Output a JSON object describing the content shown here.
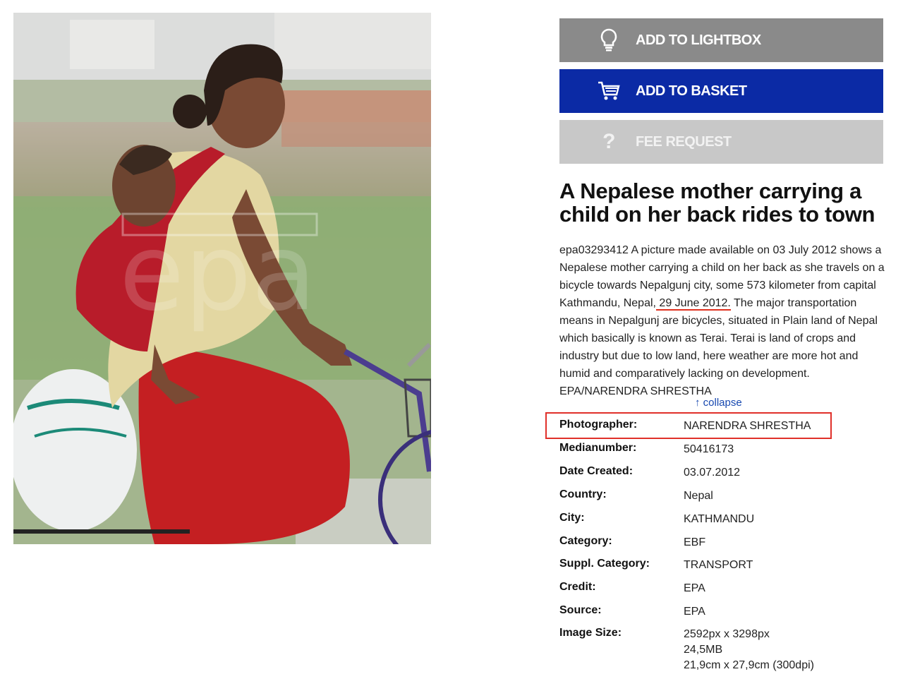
{
  "buttons": {
    "lightbox": "ADD TO LIGHTBOX",
    "basket": "ADD TO BASKET",
    "fee": "FEE REQUEST"
  },
  "icons": {
    "lightbox": "lightbulb-icon",
    "basket": "cart-icon",
    "fee": "question-mark-icon"
  },
  "colors": {
    "lightbox_bg": "#8a8a8a",
    "basket_bg": "#0b2aa5",
    "fee_bg": "#c8c8c8",
    "highlight": "#e0302a"
  },
  "photo": {
    "watermark": "epa"
  },
  "title": "A Nepalese mother carrying a child on her back rides to town",
  "description": {
    "part1": "epa03293412 A picture made available on 03 July 2012 shows a Nepalese mother carrying a child on her back as she travels on a bicycle towards Nepalgunj city, some 573 kilometer from capital Kathmandu, Nepal,",
    "date": " 29 June 2012.",
    "part2": " The major transportation means in Nepalgunj are bicycles, situated in Plain land of Nepal which basically is known as Terai. Terai is land of crops and industry but due to low land, here weather are more hot and humid and comparatively lacking on development. EPA/NARENDRA SHRESTHA"
  },
  "collapse": "↑ collapse",
  "meta": {
    "photographer": {
      "label": "Photographer:",
      "value": "NARENDRA SHRESTHA"
    },
    "medianumber": {
      "label": "Medianumber:",
      "value": "50416173"
    },
    "date_created": {
      "label": "Date Created:",
      "value": "03.07.2012"
    },
    "country": {
      "label": "Country:",
      "value": "Nepal"
    },
    "city": {
      "label": "City:",
      "value": "KATHMANDU"
    },
    "category": {
      "label": "Category:",
      "value": "EBF"
    },
    "suppl_category": {
      "label": "Suppl. Category:",
      "value": "TRANSPORT"
    },
    "credit": {
      "label": "Credit:",
      "value": "EPA"
    },
    "source": {
      "label": "Source:",
      "value": "EPA"
    },
    "image_size": {
      "label": "Image Size:",
      "px": "2592px x 3298px",
      "mb": "24,5MB",
      "cm": "21,9cm x 27,9cm (300dpi)"
    }
  }
}
